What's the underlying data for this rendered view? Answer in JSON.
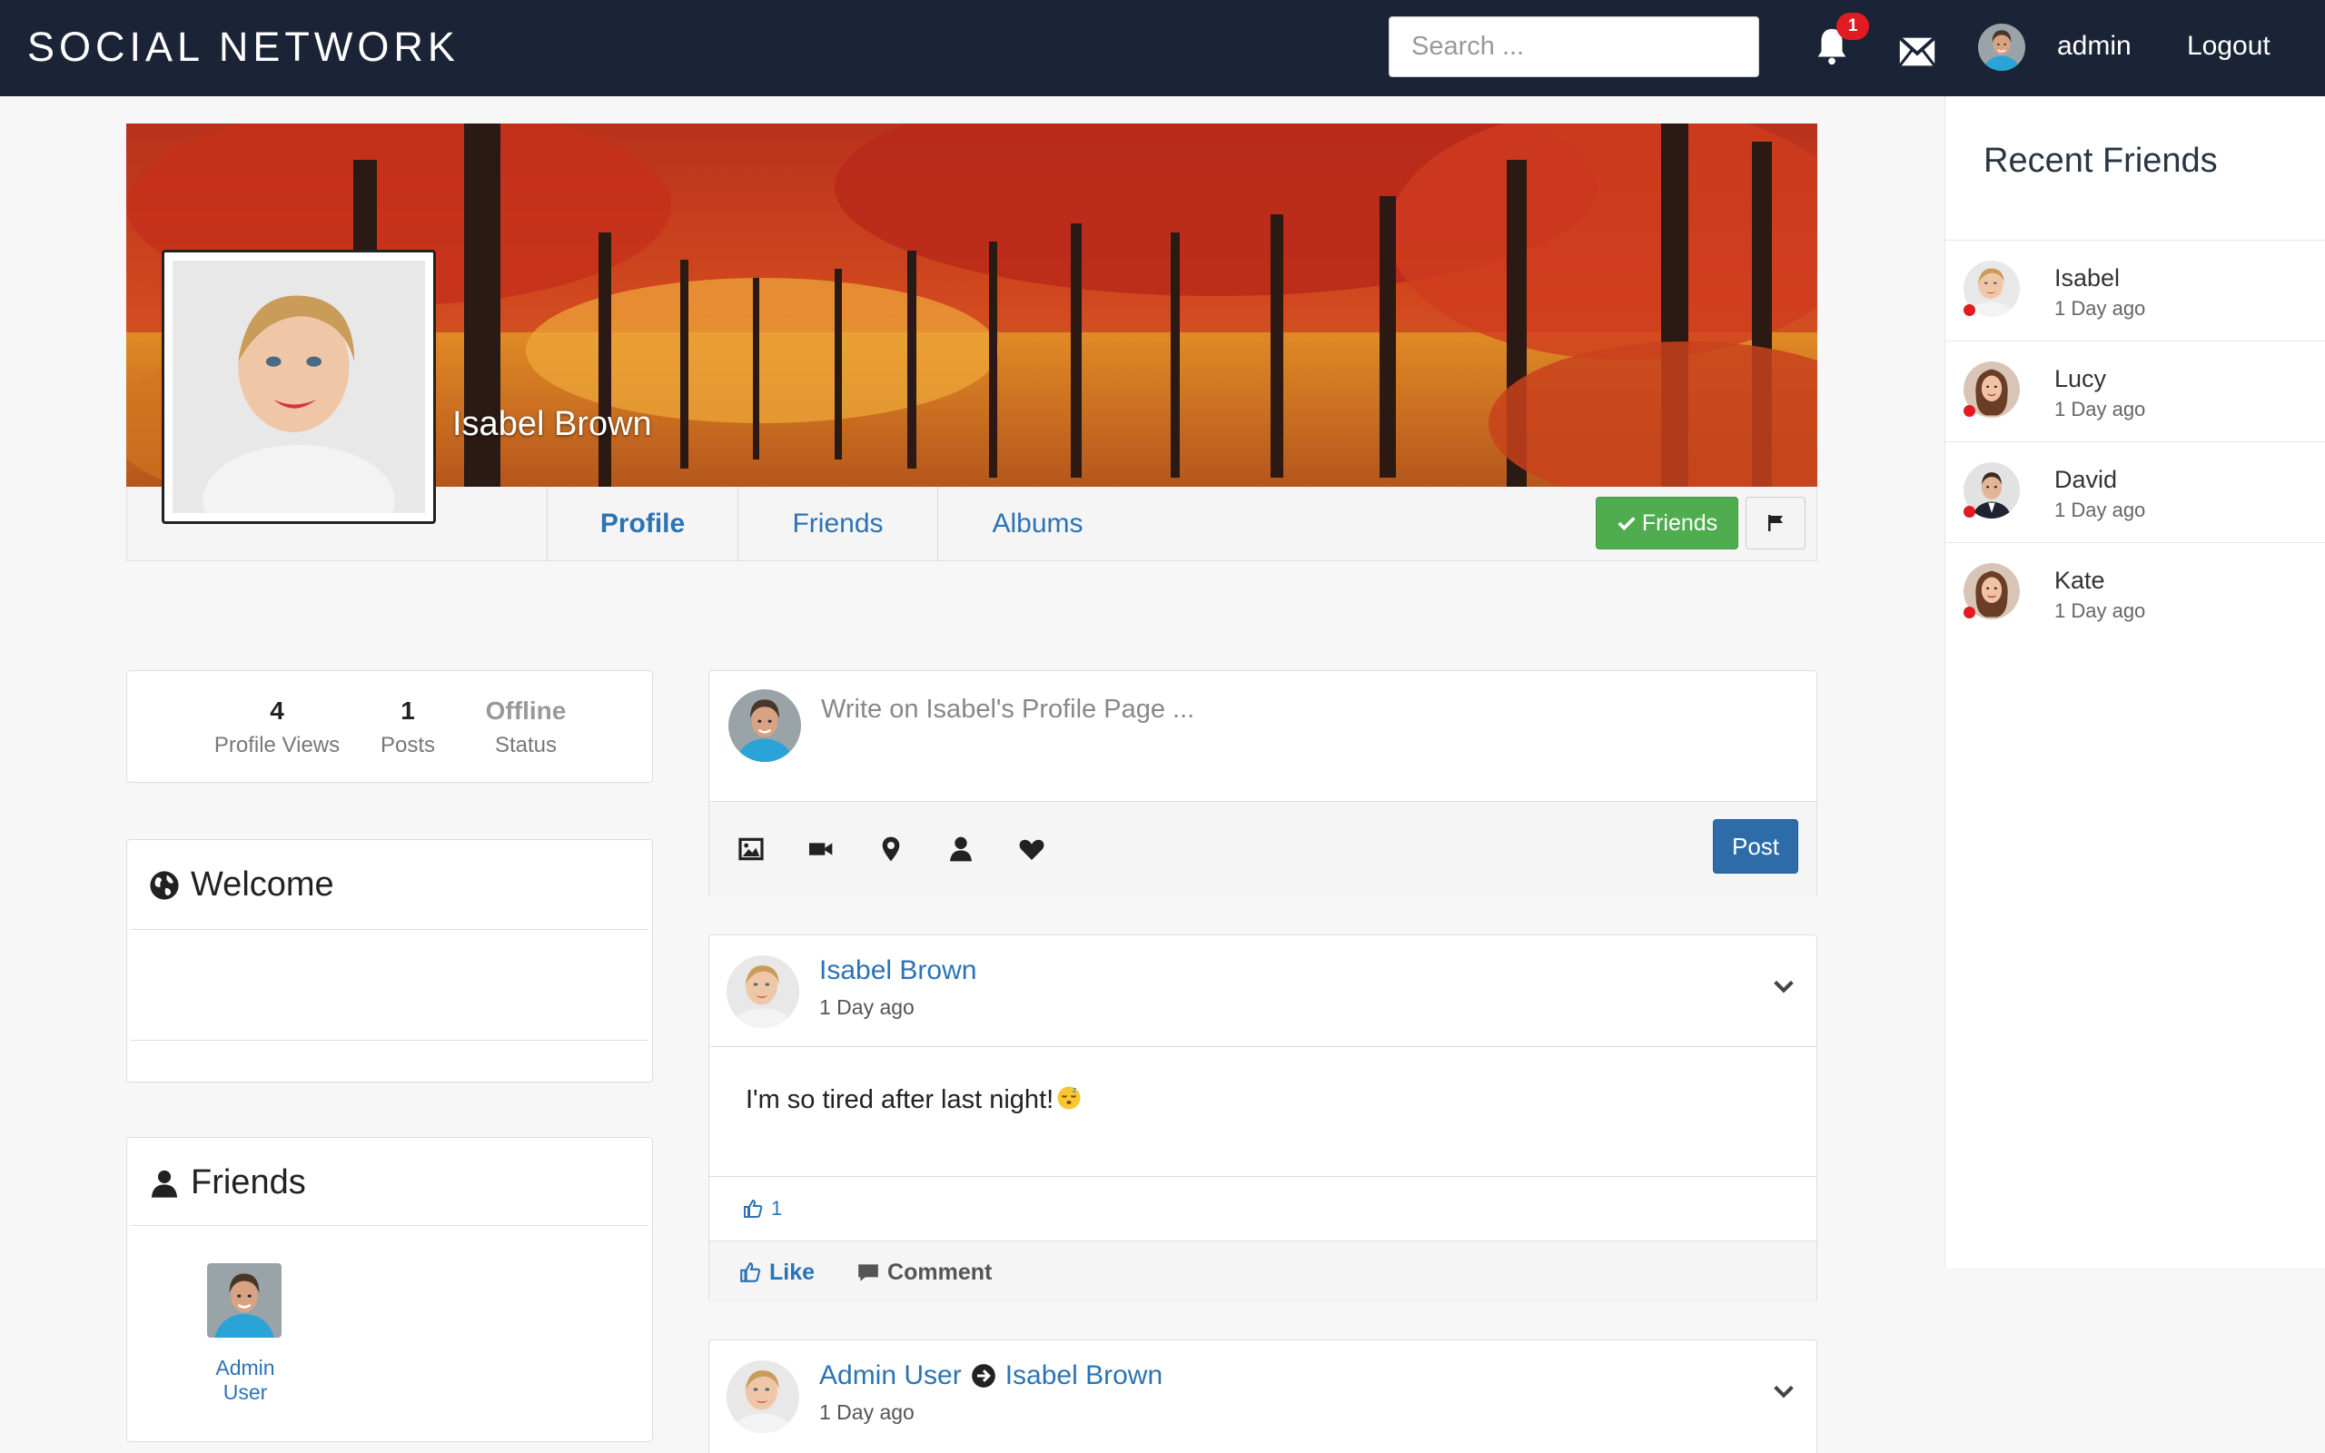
{
  "navbar": {
    "brand": "SOCIAL NETWORK",
    "search_placeholder": "Search ...",
    "notification_count": "1",
    "username": "admin",
    "logout": "Logout"
  },
  "profile": {
    "name": "Isabel Brown",
    "tabs": [
      "Profile",
      "Friends",
      "Albums"
    ],
    "friends_button": "Friends"
  },
  "stats": [
    {
      "value": "4",
      "label": "Profile Views"
    },
    {
      "value": "1",
      "label": "Posts"
    },
    {
      "value": "Offline",
      "label": "Status"
    }
  ],
  "welcome": {
    "title": "Welcome"
  },
  "friends_card": {
    "title": "Friends",
    "items": [
      {
        "name": "Admin User"
      }
    ]
  },
  "composer": {
    "placeholder": "Write on Isabel's Profile Page ...",
    "post_button": "Post"
  },
  "posts": [
    {
      "author": "Isabel Brown",
      "time": "1 Day ago",
      "body": "I'm so tired after last night!",
      "likes": "1",
      "like_label": "Like",
      "comment_label": "Comment"
    },
    {
      "author": "Admin User",
      "target": "Isabel Brown",
      "time": "1 Day ago"
    }
  ],
  "sidebar": {
    "title": "Recent Friends",
    "friends": [
      {
        "name": "Isabel",
        "time": "1 Day ago"
      },
      {
        "name": "Lucy",
        "time": "1 Day ago"
      },
      {
        "name": "David",
        "time": "1 Day ago"
      },
      {
        "name": "Kate",
        "time": "1 Day ago"
      }
    ]
  },
  "colors": {
    "navbar": "#1b2436",
    "link": "#2b73b7",
    "friends_button": "#4fad4f",
    "post_button": "#2d6ca8",
    "offline_dot": "#e21b22"
  }
}
